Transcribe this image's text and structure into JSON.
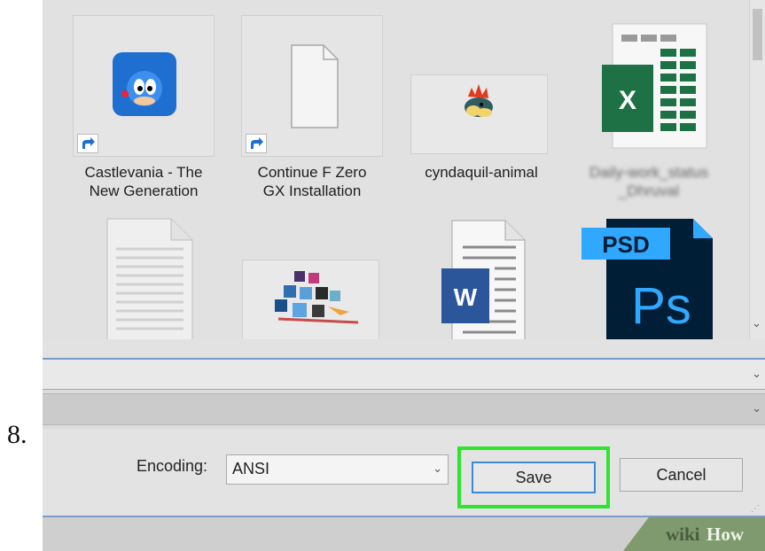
{
  "step_number": "8.",
  "files": [
    {
      "name": "Castlevania - The New Generation",
      "line1": "Castlevania - The",
      "line2": "New Generation",
      "icon": "sonic-app-icon",
      "shortcut": true
    },
    {
      "name": "Continue F Zero GX Installation",
      "line1": "Continue F Zero",
      "line2": "GX Installation",
      "icon": "blank-file-icon",
      "shortcut": true
    },
    {
      "name": "cyndaquil-animal",
      "line1": "cyndaquil-animal",
      "line2": "",
      "icon": "cyndaquil-image-thumbnail",
      "shortcut": false
    },
    {
      "name": "Daily-work_status_Dhruval",
      "line1": "Daily-work_status",
      "line2": "_Dhruval",
      "icon": "excel-file-icon",
      "shortcut": false,
      "blurred": true
    }
  ],
  "second_row_icons": [
    "text-file-icon",
    "cubes-image-thumbnail",
    "word-file-icon",
    "psd-file-icon"
  ],
  "psd_label": "PSD",
  "ps_label": "Ps",
  "word_letter": "W",
  "excel_letter": "X",
  "encoding": {
    "label": "Encoding:",
    "value": "ANSI"
  },
  "buttons": {
    "save": "Save",
    "cancel": "Cancel"
  },
  "watermark": {
    "part1": "wiki",
    "part2": "How"
  },
  "colors": {
    "highlight": "#2ee52e",
    "focus_border": "#3a8ad6",
    "excel_green": "#1e7145",
    "word_blue": "#2b579a",
    "ps_navy": "#001e36",
    "ps_blue": "#31a8ff"
  }
}
